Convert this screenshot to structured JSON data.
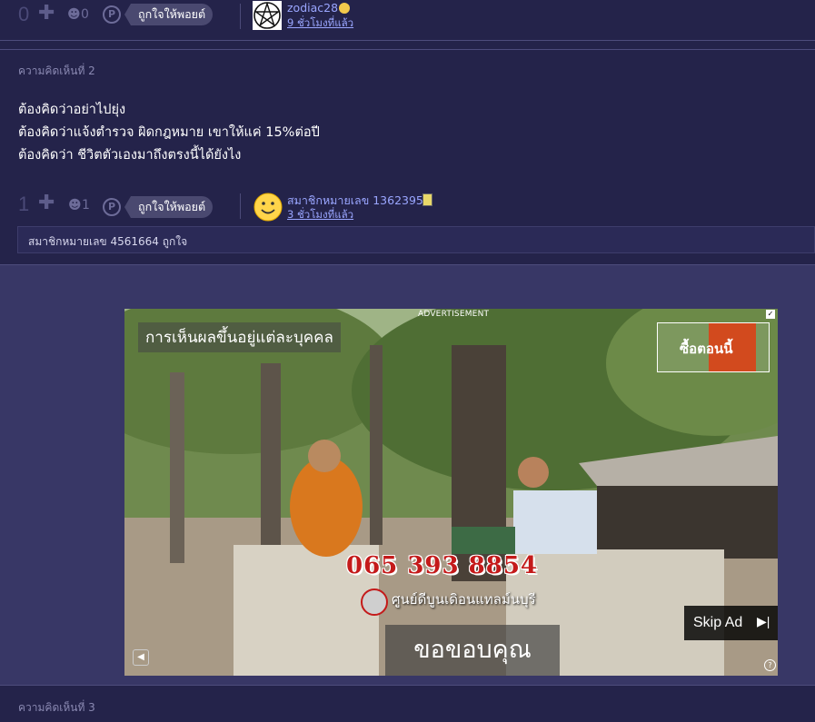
{
  "top_row": {
    "score": "0",
    "emote_count": "0",
    "like_label": "ถูกใจให้พอยต์",
    "user_name": "zodiac28",
    "user_time": "9 ชั่วโมงที่แล้ว",
    "avatar": "pentagram-avatar-icon"
  },
  "comment2": {
    "label": "ความคิดเห็นที่ 2",
    "lines": [
      "ต้องคิดว่าอย่าไปยุ่ง",
      "ต้องคิดว่าแจ้งตำรวจ ผิดกฎหมาย เขาให้แค่ 15%ต่อปี",
      "ต้องคิดว่า ชีวิตตัวเองมาถึงตรงนี้ได้ยังไง"
    ],
    "score": "1",
    "emote_count": "1",
    "like_label": "ถูกใจให้พอยต์",
    "user_name": "สมาชิกหมายเลข 1362395",
    "user_time": "3 ชั่วโมงที่แล้ว",
    "avatar": "smiley-avatar-icon",
    "likers": "สมาชิกหมายเลข 4561664 ถูกใจ"
  },
  "ad": {
    "advert_label": "ADVERTISEMENT",
    "caption": "การเห็นผลขึ้นอยู่แต่ละบุคคล",
    "buy_label": "ซื้อตอนนี้",
    "phone": "065 393 8854",
    "center_name": "ศูนย์ดีบูนเดิอนแทลม์นบุรี",
    "thanks": "ขอขอบคุณ",
    "skip_label": "Skip Ad"
  },
  "comment3": {
    "label": "ความคิดเห็นที่ 3"
  },
  "colors": {
    "background": "#24234a",
    "ad_band": "#383766",
    "link": "#9aa6ff",
    "phone_red": "#c41a1a"
  }
}
